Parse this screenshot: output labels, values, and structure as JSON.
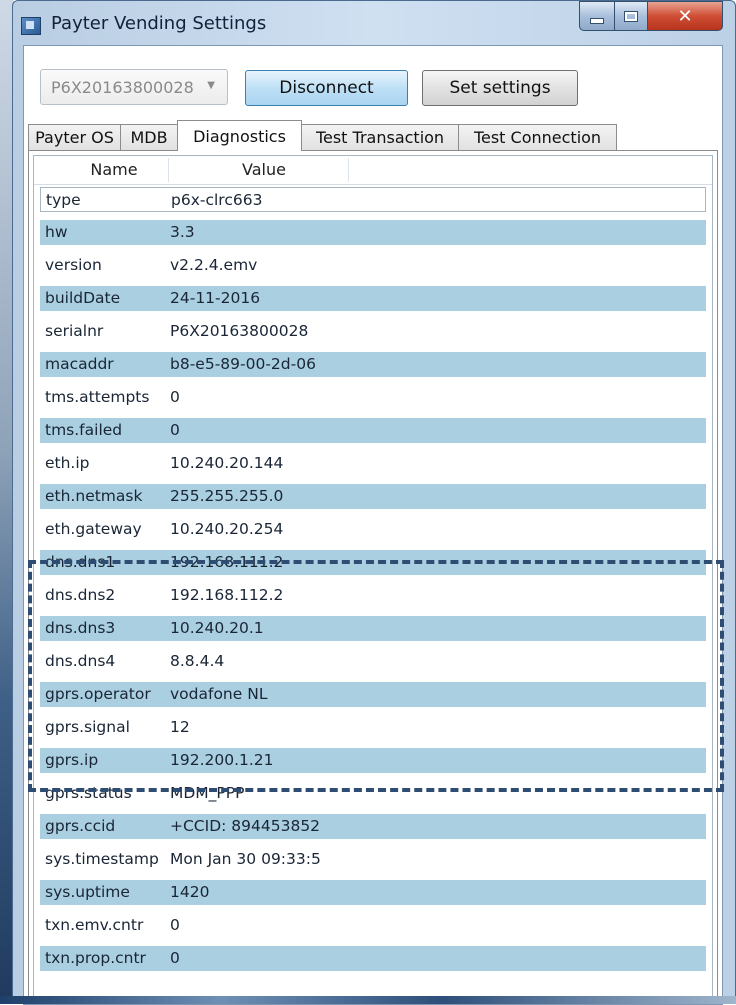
{
  "window": {
    "title": "Payter Vending Settings"
  },
  "toolbar": {
    "device_select": "P6X20163800028",
    "disconnect_label": "Disconnect",
    "set_settings_label": "Set settings"
  },
  "tabs": [
    {
      "label": "Payter OS"
    },
    {
      "label": "MDB"
    },
    {
      "label": "Diagnostics",
      "active": true
    },
    {
      "label": "Test Transaction"
    },
    {
      "label": "Test Connection"
    }
  ],
  "grid": {
    "columns": [
      "Name",
      "Value"
    ],
    "rows": [
      {
        "name": "type",
        "value": "p6x-clrc663"
      },
      {
        "name": "hw",
        "value": "3.3"
      },
      {
        "name": "version",
        "value": "v2.2.4.emv"
      },
      {
        "name": "buildDate",
        "value": "24-11-2016"
      },
      {
        "name": "serialnr",
        "value": "P6X20163800028"
      },
      {
        "name": "macaddr",
        "value": "b8-e5-89-00-2d-06"
      },
      {
        "name": "tms.attempts",
        "value": "0"
      },
      {
        "name": "tms.failed",
        "value": "0"
      },
      {
        "name": "eth.ip",
        "value": "10.240.20.144"
      },
      {
        "name": "eth.netmask",
        "value": "255.255.255.0"
      },
      {
        "name": "eth.gateway",
        "value": "10.240.20.254"
      },
      {
        "name": "dns.dns1",
        "value": "192.168.111.2"
      },
      {
        "name": "dns.dns2",
        "value": "192.168.112.2"
      },
      {
        "name": "dns.dns3",
        "value": "10.240.20.1"
      },
      {
        "name": "dns.dns4",
        "value": "8.8.4.4"
      },
      {
        "name": "gprs.operator",
        "value": "vodafone NL"
      },
      {
        "name": "gprs.signal",
        "value": "12"
      },
      {
        "name": "gprs.ip",
        "value": "192.200.1.21"
      },
      {
        "name": "gprs.status",
        "value": "MDM_PPP"
      },
      {
        "name": "gprs.ccid",
        "value": "+CCID: 894453852"
      },
      {
        "name": "sys.timestamp",
        "value": "Mon Jan 30 09:33:5"
      },
      {
        "name": "sys.uptime",
        "value": "1420"
      },
      {
        "name": "txn.emv.cntr",
        "value": "0"
      },
      {
        "name": "txn.prop.cntr",
        "value": "0"
      }
    ]
  },
  "colors": {
    "alt_row": "#a9cfe1",
    "highlight_border": "#2f4d73"
  }
}
